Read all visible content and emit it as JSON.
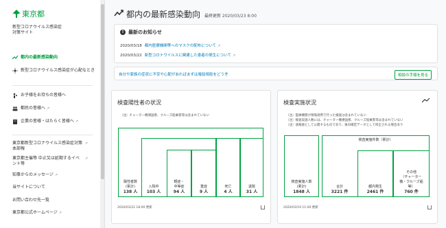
{
  "sidebar": {
    "logo_text": "東京都",
    "site_line1": "新型コロナウイルス感染症",
    "site_line2": "対策サイト",
    "items": [
      {
        "label": "都内の最新感染動向",
        "icon": "chart-icon"
      },
      {
        "label": "新型コロナウイルス感染症が心配なとき",
        "icon": "sun-icon"
      },
      {
        "label": "お子様をお持ちの皆様へ",
        "icon": "parent-icon"
      },
      {
        "label": "都民の皆様へ",
        "icon": "people-icon"
      },
      {
        "label": "企業の皆様・はたらく皆様へ",
        "icon": "building-icon"
      },
      {
        "label": "東京都新型コロナウイルス感染症対策本部報"
      },
      {
        "label": "東京都主催等 中止又は延期するイベント等"
      },
      {
        "label": "知事からのメッセージ"
      },
      {
        "label": "当サイトについて"
      },
      {
        "label": "お問い合わせ先一覧"
      },
      {
        "label": "東京都公式ホームページ"
      }
    ]
  },
  "header": {
    "title": "都内の最新感染動向",
    "updated": "最終更新 2020/03/23 8:00"
  },
  "news": {
    "title": "最新のお知らせ",
    "items": [
      {
        "date": "2020/03/18",
        "text": "都内医療機関等へのマスクの配布について"
      },
      {
        "date": "2020/03/22",
        "text": "新型コロナウイルスに関連した患者の発生について"
      }
    ]
  },
  "consult": {
    "text": "自分や家族の症状に不安や心配があればまずは電話相談をどうぞ",
    "button": "相談の手順を見る"
  },
  "positive_card": {
    "title": "検査陽性者の状況",
    "note": "（注）チャーター機帰国者、クルーズ船乗客等は含まれていない",
    "boxes": [
      {
        "label": "陽性者数\n(累計)",
        "value": "138 人"
      },
      {
        "label": "入院中",
        "value": "103 人"
      },
      {
        "label": "軽症・\n中等症",
        "value": "94 人"
      },
      {
        "label": "重症",
        "value": "9 人"
      },
      {
        "label": "死亡",
        "value": "4 人"
      },
      {
        "label": "退院",
        "value": "31 人"
      }
    ],
    "footer": "2020/03/22 18:00 更新"
  },
  "test_card": {
    "title": "検査実施状況",
    "notes": [
      "（注）医療機関が保険適用で行った検査は含まれていない",
      "（注）検査実施人数には、チャーター機帰国者、クルーズ船乗客等は含まれていない",
      "（注）速報値として公開するものであり、後日確定データとして修正される場合あり"
    ],
    "group_label": "検査実施件数（累計）",
    "boxes": [
      {
        "label": "検査実施人数\n(累計)",
        "value": "1848 人"
      },
      {
        "label": "合計",
        "value": "3221 件"
      },
      {
        "label": "都内発生",
        "value": "2461 件"
      },
      {
        "label": "その他\n（チャーター\n機・クルーズ船\n等）",
        "value": "760 件"
      }
    ],
    "footer": "2020/03/19 11:00 更新"
  },
  "colors": {
    "accent": "#00a040",
    "link": "#007bbb"
  }
}
